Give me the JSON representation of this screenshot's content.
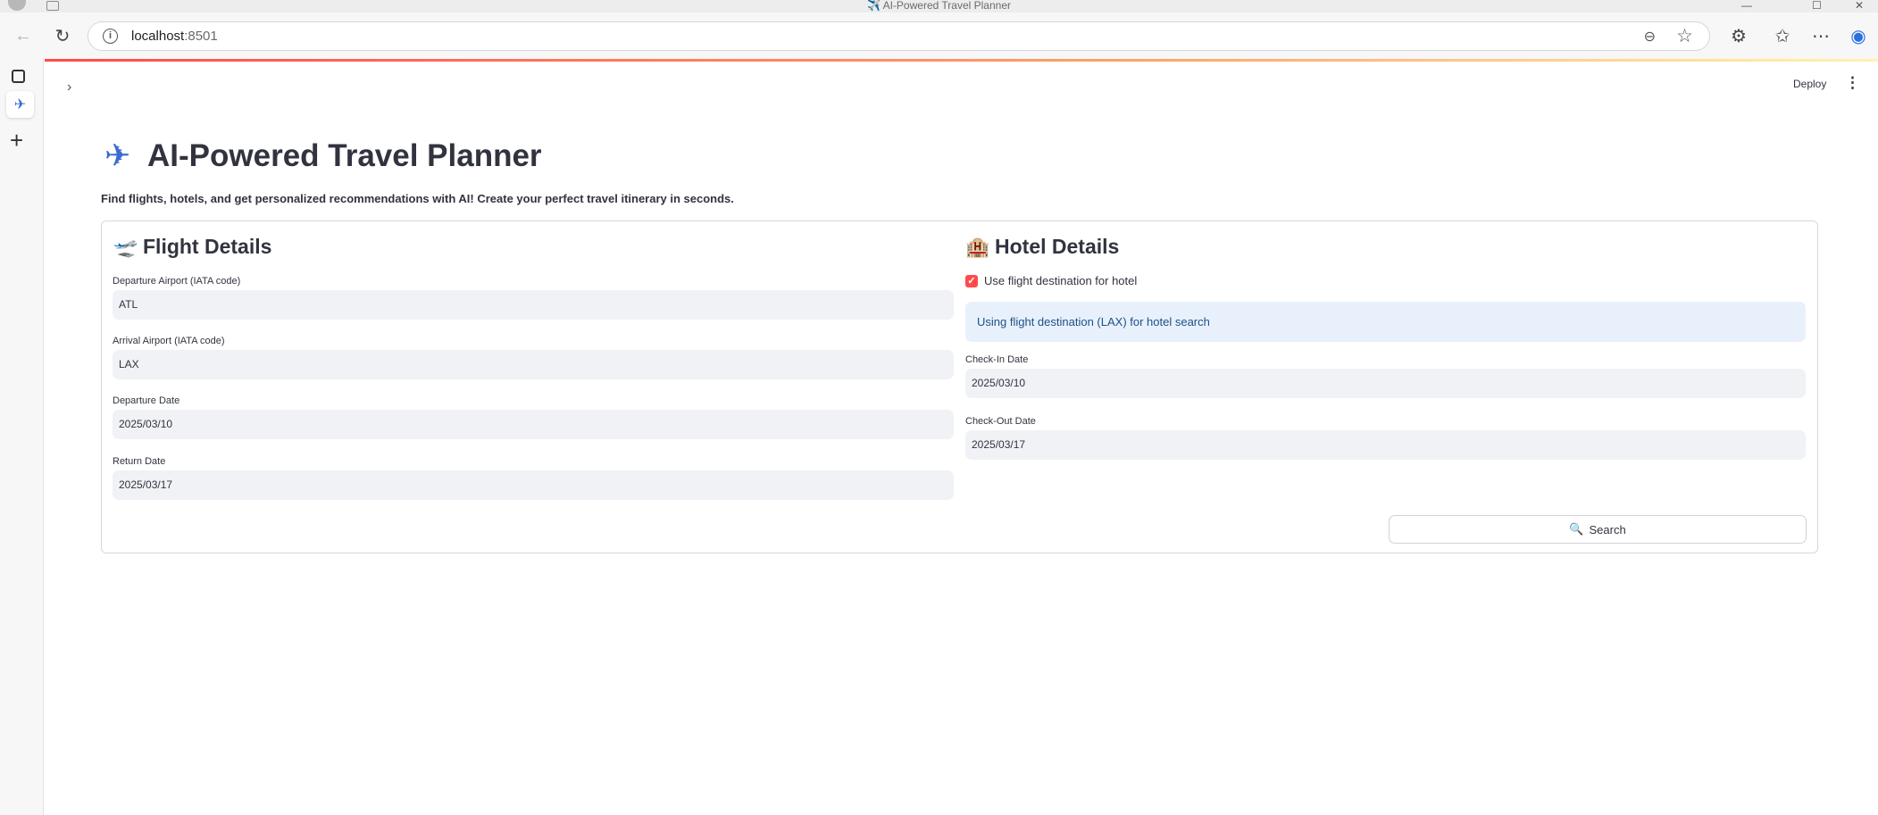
{
  "browser": {
    "tab_title": "✈️ AI-Powered Travel Planner",
    "url_host": "localhost",
    "url_port": ":8501",
    "window_controls": [
      "—",
      "☐",
      "✕"
    ]
  },
  "app_header": {
    "deploy_label": "Deploy",
    "menu_icon": "⋮",
    "sidebar_toggle_icon": "›"
  },
  "page": {
    "title_emoji": "✈",
    "title": "AI-Powered Travel Planner",
    "subtitle": "Find flights, hotels, and get personalized recommendations with AI! Create your perfect travel itinerary in seconds."
  },
  "flight": {
    "icon": "🛫",
    "heading": "Flight Details",
    "departure_airport_label": "Departure Airport (IATA code)",
    "departure_airport_value": "ATL",
    "arrival_airport_label": "Arrival Airport (IATA code)",
    "arrival_airport_value": "LAX",
    "departure_date_label": "Departure Date",
    "departure_date_value": "2025/03/10",
    "return_date_label": "Return Date",
    "return_date_value": "2025/03/17"
  },
  "hotel": {
    "icon": "🏨",
    "heading": "Hotel Details",
    "use_flight_dest_label": "Use flight destination for hotel",
    "use_flight_dest_checked": true,
    "info_message": "Using flight destination (LAX) for hotel search",
    "checkin_label": "Check-In Date",
    "checkin_value": "2025/03/10",
    "checkout_label": "Check-Out Date",
    "checkout_value": "2025/03/17"
  },
  "search_button": {
    "icon": "🔍",
    "label": "Search"
  },
  "colors": {
    "accent_red": "#ff4b4b",
    "input_bg": "#f0f2f6",
    "info_bg": "#e8f1fb",
    "text": "#31333f"
  }
}
